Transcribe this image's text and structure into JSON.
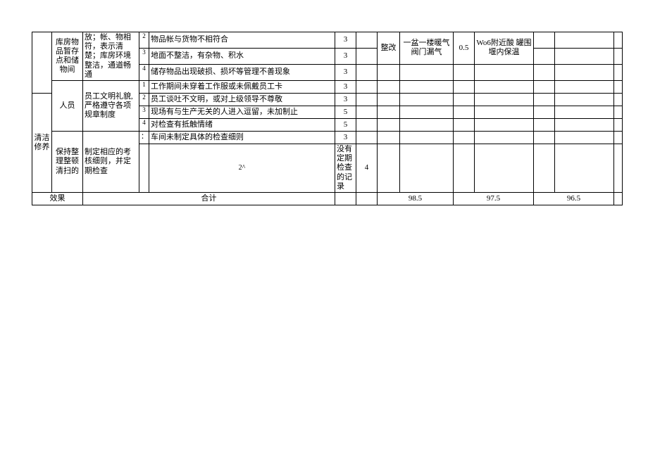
{
  "c1_section1": "",
  "c1_section2": "清洁修养",
  "c2_r1": "库房物品暂存 点和储物间",
  "c2_r5": "人员",
  "c2_r9": "保持整理整顿清扫的",
  "c3_r1": "放；帐、物相符，表示清楚；库房环境整洁，通道畅通",
  "c3_r5": "员工文明礼貌,严格遵守各项规章制度",
  "c3_r9": "制定相应的考核细则，并定期检查",
  "idx": {
    "r1": "2",
    "r2": "3",
    "r3": "4",
    "r4": "1",
    "r5": "2",
    "r6": "3",
    "r7": "4",
    "r8": "：",
    "r9": "2^"
  },
  "desc": {
    "r1": "物品帐与货物不相符合",
    "r2": "地面不整洁，有杂物、积水",
    "r3": "储存物品出现破损、损坏等管理不善现象",
    "r4": "工作期间未穿着工作服或未佩戴员工卡",
    "r5": "员工谈吐不文明，或对上级领导不尊敬",
    "r6": "现场有与生产无关的人进入逗留，未加制止",
    "r7": "对检查有抵触情绪",
    "r8": "车间未制定具体的检查细则",
    "r9": "没有定期检查的记录"
  },
  "score": {
    "r1": "3",
    "r2": "3",
    "r3": "3",
    "r4": "3",
    "r5": "3",
    "r6": "5",
    "r7": "5",
    "r8": "3",
    "r9": "4"
  },
  "row2": {
    "c6": "",
    "c7": "整改",
    "c8": "一盆一楼暖气阀门漏气",
    "c9": "0.5",
    "c10": "Wo6附近酸 罐围堰内保温",
    "c11": "",
    "c12": ""
  },
  "footer": {
    "label1": "效果",
    "label2": "合计",
    "s1": "98.5",
    "s2": "97.5",
    "s3": "96.5"
  }
}
